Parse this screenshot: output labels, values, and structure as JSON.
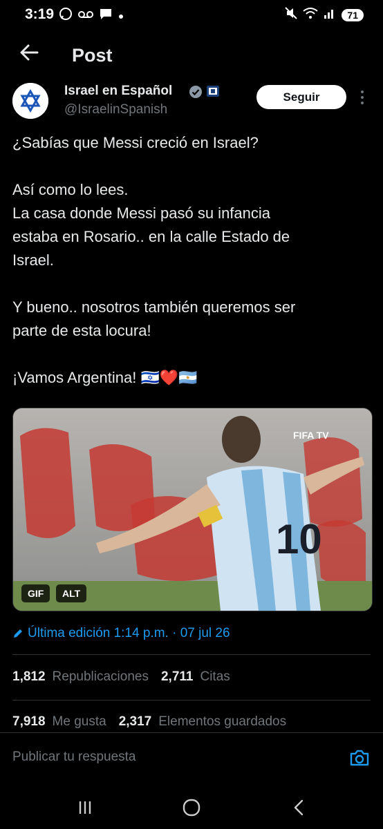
{
  "status_bar": {
    "time": "3:19",
    "battery": "71"
  },
  "header": {
    "title": "Post"
  },
  "post": {
    "author_name": "Israel en Español",
    "handle": "@IsraelinSpanish",
    "follow_label": "Seguir",
    "text_lines": {
      "l1": "¿Sabías que Messi creció en Israel?",
      "l2": "Así como lo lees.",
      "l3": "La casa donde Messi pasó su infancia",
      "l4": "estaba en Rosario.. en la calle Estado de",
      "l5": "Israel.",
      "l6": "Y bueno.. nosotros también queremos ser",
      "l7": "parte de esta locura!",
      "l8": "¡Vamos Argentina! 🇮🇱❤️🇦🇷"
    },
    "media": {
      "gif_label": "GIF",
      "alt_label": "ALT",
      "watermark": "FIFA TV",
      "jersey_number": "10"
    },
    "edited": "Última edición 1:14 p.m. · 07 jul 26",
    "stats": {
      "reposts_count": "1,812",
      "reposts_label": "Republicaciones",
      "quotes_count": "2,711",
      "quotes_label": "Citas",
      "likes_count": "7,918",
      "likes_label": "Me gusta",
      "bookmarks_count": "2,317",
      "bookmarks_label": "Elementos guardados"
    }
  },
  "reply": {
    "placeholder": "Publicar tu respuesta"
  },
  "colors": {
    "background": "#000000",
    "accent": "#1d9bf0",
    "text": "#e7e9ea",
    "muted": "#71767b"
  }
}
